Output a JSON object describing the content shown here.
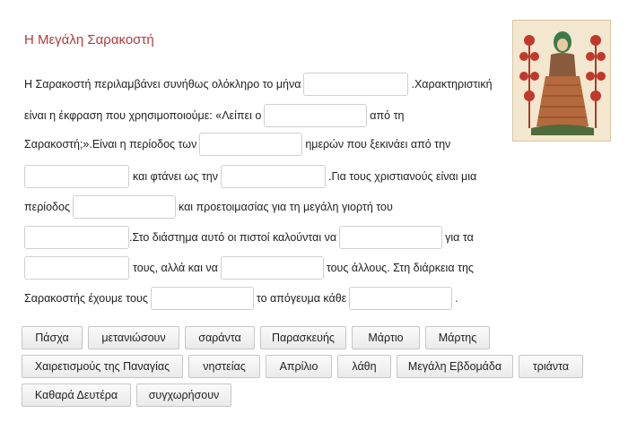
{
  "title": "Η Μεγάλη Σαρακοστή",
  "image": {
    "name": "icon-lent-figure"
  },
  "text": {
    "l1a": "Η Σαρακοστή περιλαμβάνει συνήθως ολόκληρο το μήνα",
    "l1b": ".Χαρακτηριστική",
    "l2a": "είναι η  έκφραση που χρησιμοποιούμε: «Λείπει ο",
    "l2b": "από τη",
    "l3a": "Σαρακοστή;».Είναι η περίοδος των",
    "l3b": "ημερών που ξεκινάει από την",
    "l4a": "και φτάνει ως την",
    "l4b": ".Για τους χριστιανούς είναι μια",
    "l5a": "περίοδος",
    "l5b": "και προετοιμασίας για τη μεγάλη γιορτή του",
    "l6a": ".Στο διάστημα αυτό οι πιστοί καλούνται να",
    "l6b": "για τα",
    "l7a": "τους, αλλά και να",
    "l7b": "τους άλλους. Στη διάρκεια της",
    "l8a": "Σαρακοστής έχουμε τους",
    "l8b": "το απόγευμα κάθε",
    "l8c": "."
  },
  "options": [
    "Πάσχα",
    "μετανιώσουν",
    "σαράντα",
    "Παρασκευής",
    "Μάρτιο",
    "Μάρτης",
    "Χαιρετισμούς της Παναγίας",
    "νηστείας",
    "Απρίλιο",
    "λάθη",
    "Μεγάλη Εβδομάδα",
    "τριάντα",
    "Καθαρά Δευτέρα",
    "συγχωρήσουν"
  ]
}
